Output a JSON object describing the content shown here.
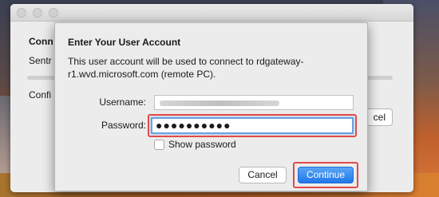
{
  "background_window": {
    "connecting_label": "Conn",
    "status_label": "Sentr",
    "config_label": "Confi",
    "cancel_label": "cel"
  },
  "dialog": {
    "title": "Enter Your User Account",
    "description": "This user account will be used to connect to rdgateway-r1.wvd.microsoft.com (remote PC).",
    "username_label": "Username:",
    "username_value": "",
    "password_label": "Password:",
    "password_value": "●●●●●●●●●●",
    "show_password_label": "Show password",
    "show_password_checked": false,
    "cancel_label": "Cancel",
    "continue_label": "Continue"
  },
  "colors": {
    "highlight": "#e04a4a",
    "primary_button": "#2077e8",
    "focus_ring": "#6aa2e0"
  }
}
